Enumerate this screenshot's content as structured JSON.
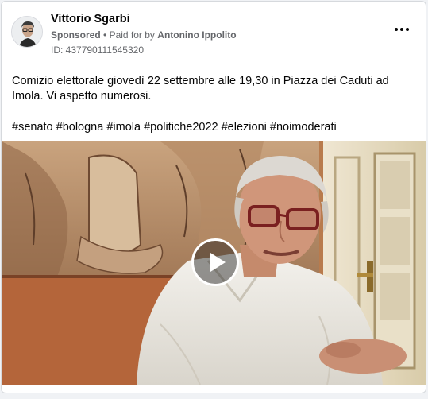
{
  "post": {
    "author": "Vittorio Sgarbi",
    "sponsored": "Sponsored",
    "separator": "•",
    "paid_prefix": "Paid for by",
    "paid_by": "Antonino Ippolito",
    "ad_id": "ID: 437790111545320",
    "body": "Comizio elettorale giovedì 22 settembre alle 19,30 in Piazza dei Caduti ad Imola. Vi aspetto numerosi.",
    "hashtags": "#senato #bologna #imola #politiche2022 #elezioni #noimoderati"
  },
  "icons": {
    "more": "more-horizontal-icon",
    "play": "play-icon"
  },
  "colors": {
    "text_primary": "#050505",
    "text_secondary": "#65676b",
    "card_bg": "#ffffff",
    "page_bg": "#f0f2f5"
  }
}
